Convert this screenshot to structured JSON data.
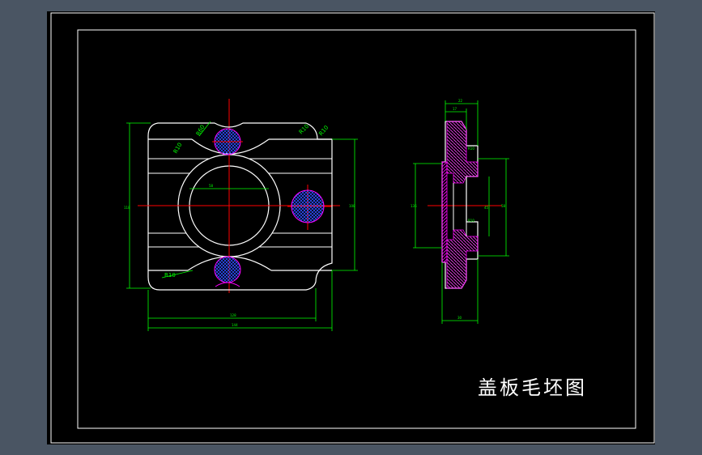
{
  "drawing": {
    "title": "盖板毛坯图",
    "radius_labels": {
      "r60": "R60",
      "r10_a": "R10",
      "r10_b": "R10",
      "r10_c": "R10",
      "r10_bottom": "R10"
    },
    "dimension_labels": {
      "overall_width": "144",
      "bottom_width": "128",
      "overall_height": "118",
      "right_height": "108",
      "bore_diameter": "58",
      "side_width": "30",
      "side_top_a": "22",
      "side_top_b": "17",
      "side_height_left": "136",
      "side_height_right": "58",
      "side_inner": "45"
    },
    "colors": {
      "background": "#000000",
      "frame": "#ffffff",
      "outline": "#ffffff",
      "center_line": "#ff0000",
      "dimension": "#00ff00",
      "hatch": "#ff00ff",
      "hatch_fill": "#2040ff"
    }
  }
}
